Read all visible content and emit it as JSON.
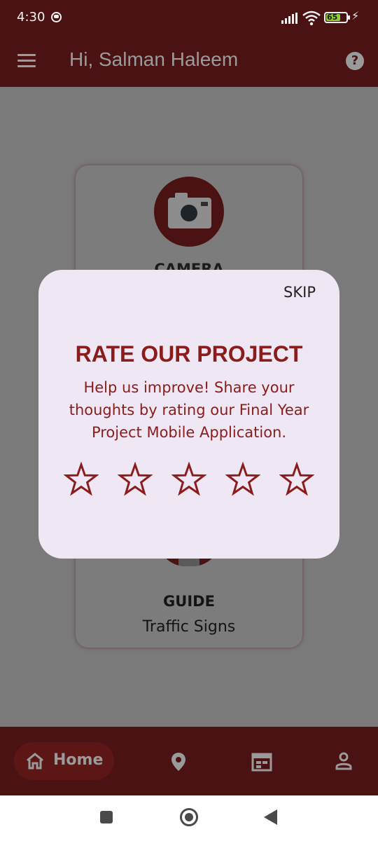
{
  "status_bar": {
    "time": "4:30",
    "battery_level": "65",
    "icons": [
      "clock-icon",
      "signal-icon",
      "wifi-icon",
      "battery-icon",
      "charging-icon"
    ]
  },
  "app_bar": {
    "title": "Hi, Salman Haleem",
    "menu_icon": "menu-icon",
    "help_icon": "help-icon"
  },
  "cards": {
    "camera_label": "CAMERA",
    "guide_label": "GUIDE",
    "guide_sub": "Traffic Signs"
  },
  "dialog": {
    "skip_label": "SKIP",
    "title": "RATE OUR PROJECT",
    "body": "Help us improve! Share your thoughts by rating our Final Year Project Mobile Application.",
    "rating": {
      "value": 0,
      "max": 5
    }
  },
  "bottom_nav": {
    "items": [
      {
        "label": "Home",
        "icon": "home-icon",
        "active": true
      },
      {
        "label": "",
        "icon": "location-pin-icon",
        "active": false
      },
      {
        "label": "",
        "icon": "calendar-icon",
        "active": false
      },
      {
        "label": "",
        "icon": "profile-icon",
        "active": false
      }
    ]
  },
  "colors": {
    "primary": "#4a1212",
    "accent": "#8b1c1c",
    "dialog_bg": "#efe7f3",
    "scrim": "#7a7a7a"
  }
}
